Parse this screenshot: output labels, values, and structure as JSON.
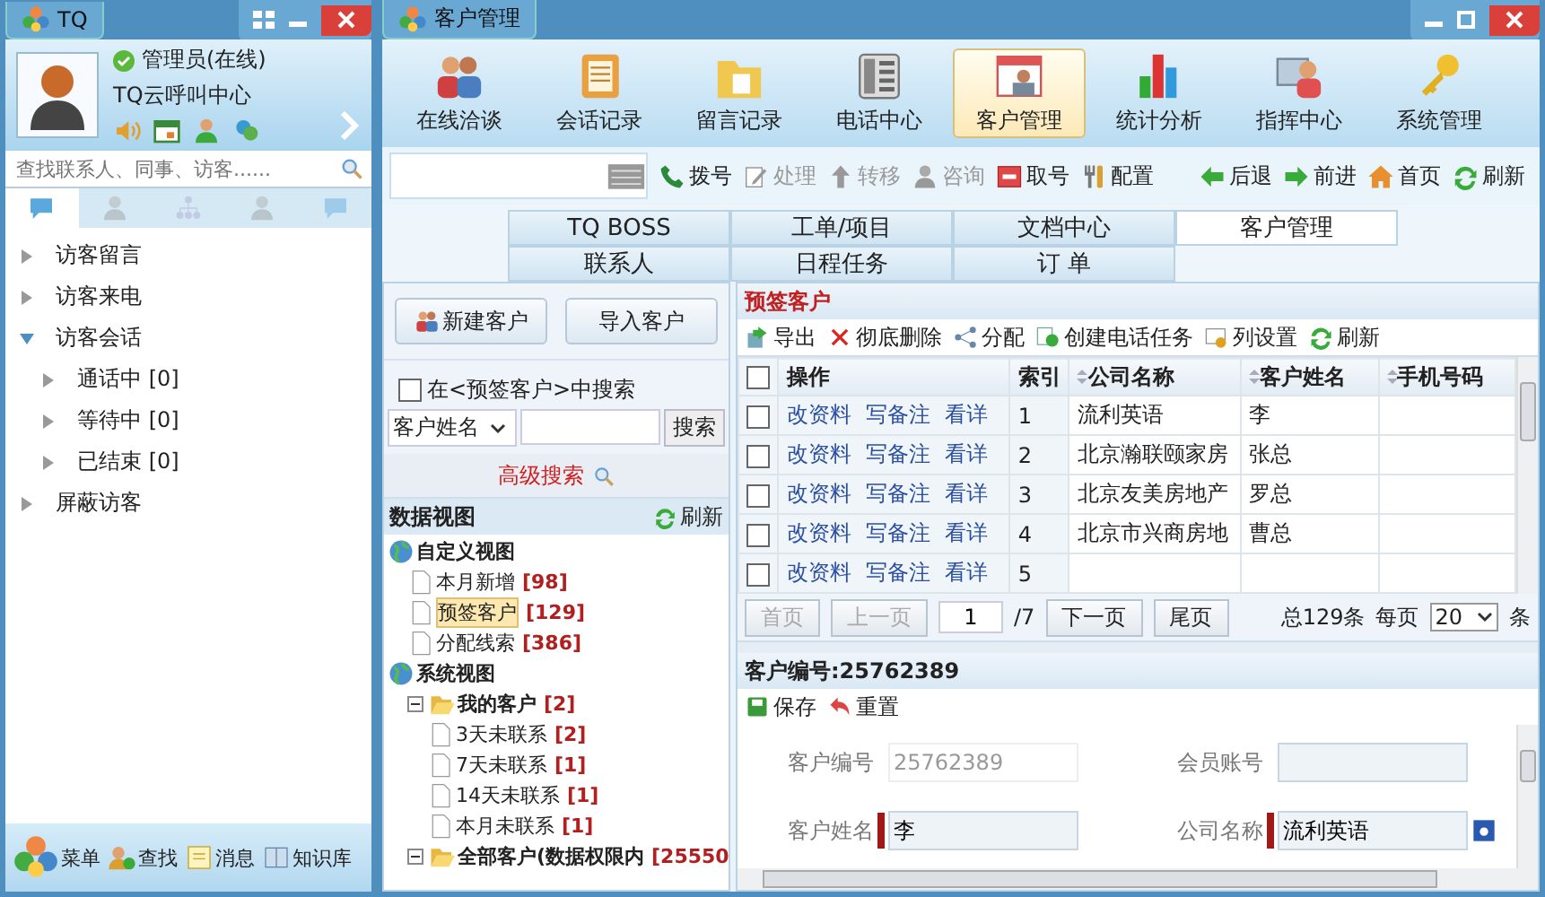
{
  "left_window": {
    "title": "TQ",
    "user": {
      "name": "管理员(在线)",
      "online": true,
      "org": "TQ云呼叫中心"
    },
    "search": {
      "placeholder": "查找联系人、同事、访客......"
    },
    "tabs": [
      {
        "selected": true
      },
      {
        "selected": false
      },
      {
        "selected": false
      },
      {
        "selected": false
      },
      {
        "selected": false
      }
    ],
    "tree": [
      {
        "label": "访客留言",
        "expanded": false
      },
      {
        "label": "访客来电",
        "expanded": false
      },
      {
        "label": "访客会话",
        "expanded": true,
        "children": [
          {
            "label": "通话中 [0]",
            "expanded": false
          },
          {
            "label": "等待中 [0]",
            "expanded": false
          },
          {
            "label": "已结束 [0]",
            "expanded": false
          }
        ]
      },
      {
        "label": "屏蔽访客",
        "expanded": false
      }
    ],
    "bottom_bar": [
      "菜单",
      "查找",
      "消息",
      "知识库"
    ]
  },
  "right_window": {
    "title": "客户管理",
    "nav": [
      {
        "label": "在线洽谈",
        "selected": false
      },
      {
        "label": "会话记录",
        "selected": false
      },
      {
        "label": "留言记录",
        "selected": false
      },
      {
        "label": "电话中心",
        "selected": false
      },
      {
        "label": "客户管理",
        "selected": true
      },
      {
        "label": "统计分析",
        "selected": false
      },
      {
        "label": "指挥中心",
        "selected": false
      },
      {
        "label": "系统管理",
        "selected": false
      }
    ],
    "phone_actions": [
      {
        "label": "拨号",
        "disabled": false
      },
      {
        "label": "处理",
        "disabled": true
      },
      {
        "label": "转移",
        "disabled": true
      },
      {
        "label": "咨询",
        "disabled": true
      },
      {
        "label": "取号",
        "disabled": false
      },
      {
        "label": "配置",
        "disabled": false
      }
    ],
    "browse_actions": [
      "后退",
      "前进",
      "首页",
      "刷新"
    ],
    "module_tabs": [
      [
        {
          "label": "TQ BOSS",
          "selected": false
        },
        {
          "label": "工单/项目",
          "selected": false
        },
        {
          "label": "文档中心",
          "selected": false
        },
        {
          "label": "客户管理",
          "selected": true
        }
      ],
      [
        {
          "label": "联系人",
          "selected": false
        },
        {
          "label": "日程任务",
          "selected": false
        },
        {
          "label": "订 单",
          "selected": false
        }
      ]
    ],
    "side": {
      "buttons": [
        "新建客户",
        "导入客户"
      ],
      "scope_search": {
        "label": "在<预签客户>中搜索",
        "checked": false
      },
      "search_field": "客户姓名",
      "search_button": "搜索",
      "advanced_search": "高级搜索",
      "data_view": {
        "title": "数据视图",
        "refresh": "刷新",
        "tree": [
          {
            "label": "自定义视图",
            "kind": "root",
            "children": [
              {
                "label": "本月新增",
                "count": "[98]",
                "kind": "leaf",
                "selected": false
              },
              {
                "label": "预签客户",
                "count": "[129]",
                "kind": "leaf",
                "selected": true
              },
              {
                "label": "分配线索",
                "count": "[386]",
                "kind": "leaf",
                "selected": false
              }
            ]
          },
          {
            "label": "系统视图",
            "kind": "root",
            "children": [
              {
                "label": "我的客户",
                "count": "[2]",
                "kind": "folder",
                "expanded": true,
                "children": [
                  {
                    "label": "3天未联系",
                    "count": "[2]",
                    "kind": "leaf",
                    "selected": false
                  },
                  {
                    "label": "7天未联系",
                    "count": "[1]",
                    "kind": "leaf",
                    "selected": false
                  },
                  {
                    "label": "14天未联系",
                    "count": "[1]",
                    "kind": "leaf",
                    "selected": false
                  },
                  {
                    "label": "本月未联系",
                    "count": "[1]",
                    "kind": "leaf",
                    "selected": false
                  }
                ]
              },
              {
                "label": "全部客户(数据权限内",
                "count": "[25550",
                "kind": "folder",
                "expanded": true
              }
            ]
          }
        ]
      }
    }
  },
  "list": {
    "title": "预签客户",
    "toolbar": [
      "导出",
      "彻底删除",
      "分配",
      "创建电话任务",
      "列设置",
      "刷新"
    ],
    "all_checked": false,
    "columns": [
      "操作",
      "索引",
      "公司名称",
      "客户姓名",
      "手机号码"
    ],
    "rows": [
      {
        "checked": false,
        "actions": [
          "改资料",
          "写备注",
          "看详"
        ],
        "index": "1",
        "company": "流利英语",
        "name": "李"
      },
      {
        "checked": false,
        "actions": [
          "改资料",
          "写备注",
          "看详"
        ],
        "index": "2",
        "company": "北京瀚联颐家房",
        "name": "张总"
      },
      {
        "checked": false,
        "actions": [
          "改资料",
          "写备注",
          "看详"
        ],
        "index": "3",
        "company": "北京友美房地产",
        "name": "罗总"
      },
      {
        "checked": false,
        "actions": [
          "改资料",
          "写备注",
          "看详"
        ],
        "index": "4",
        "company": "北京市兴商房地",
        "name": "曹总"
      },
      {
        "checked": false,
        "actions": [
          "改资料",
          "写备注",
          "看详"
        ],
        "index": "5"
      }
    ],
    "pager": {
      "buttons": [
        {
          "label": "首页",
          "disabled": true
        },
        {
          "label": "上一页",
          "disabled": true
        }
      ],
      "page": "1",
      "total_pages": "/7",
      "next": [
        {
          "label": "下一页",
          "disabled": false
        },
        {
          "label": "尾页",
          "disabled": false
        }
      ],
      "total": "总129条",
      "per_page_label": "每页",
      "per_page": "20",
      "unit": "条"
    }
  },
  "detail": {
    "title": "客户编号:25762389",
    "actions": [
      "保存",
      "重置"
    ],
    "fields": [
      {
        "label": "客户编号",
        "value": "25762389",
        "readonly": true,
        "required": false
      },
      {
        "label": "会员账号",
        "readonly": false,
        "required": false
      },
      {
        "label": "客户姓名",
        "value": "李",
        "readonly": false,
        "required": true
      },
      {
        "label": "公司名称",
        "value": "流利英语",
        "readonly": false,
        "required": true
      }
    ]
  }
}
